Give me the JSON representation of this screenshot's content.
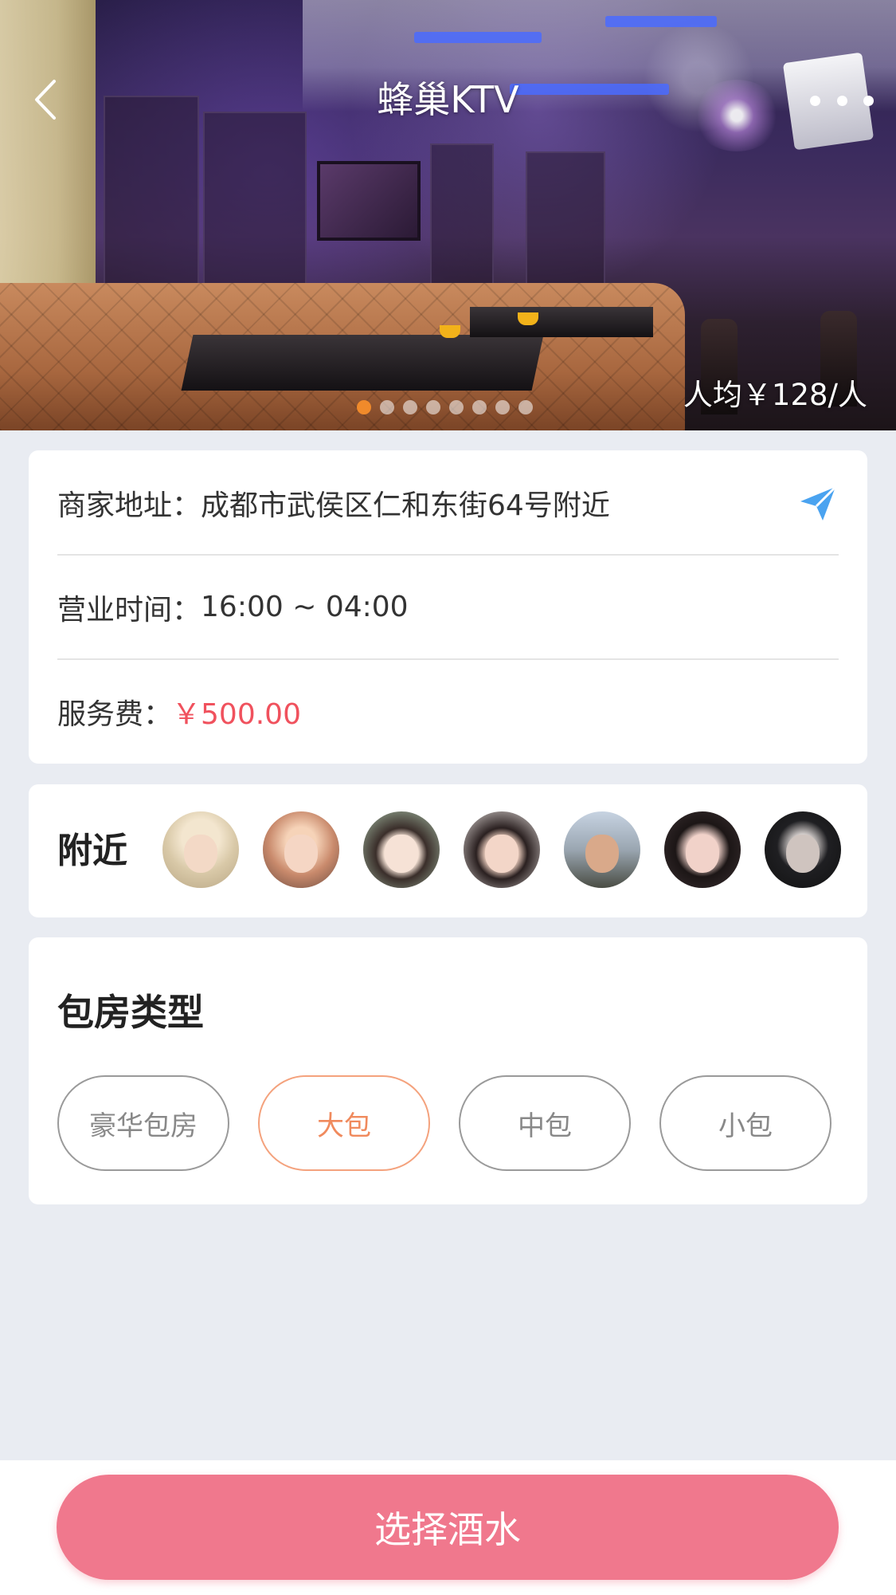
{
  "header": {
    "title": "蜂巢KTV",
    "avg_price": "人均￥128/人",
    "carousel_total": 8,
    "carousel_active": 1
  },
  "info": {
    "address_label": "商家地址：",
    "address_value": "成都市武侯区仁和东街64号附近",
    "hours_label": "营业时间：",
    "hours_value": "16:00 ~ 04:00",
    "fee_label": "服务费：",
    "fee_value": "￥500.00"
  },
  "nearby": {
    "title": "附近",
    "avatar_count": 7
  },
  "room_type": {
    "title": "包房类型",
    "options": [
      "豪华包房",
      "大包",
      "中包",
      "小包"
    ],
    "selected": "大包"
  },
  "cta": {
    "label": "选择酒水"
  },
  "colors": {
    "accent_orange": "#f08a2b",
    "price_red": "#f0515d",
    "cta_pink": "#f0788d",
    "nav_icon_blue": "#4aa3f0",
    "page_bg": "#e9ecf2"
  },
  "icons": {
    "back": "chevron-left-icon",
    "more": "more-dots-icon",
    "navigate": "paper-plane-icon"
  }
}
